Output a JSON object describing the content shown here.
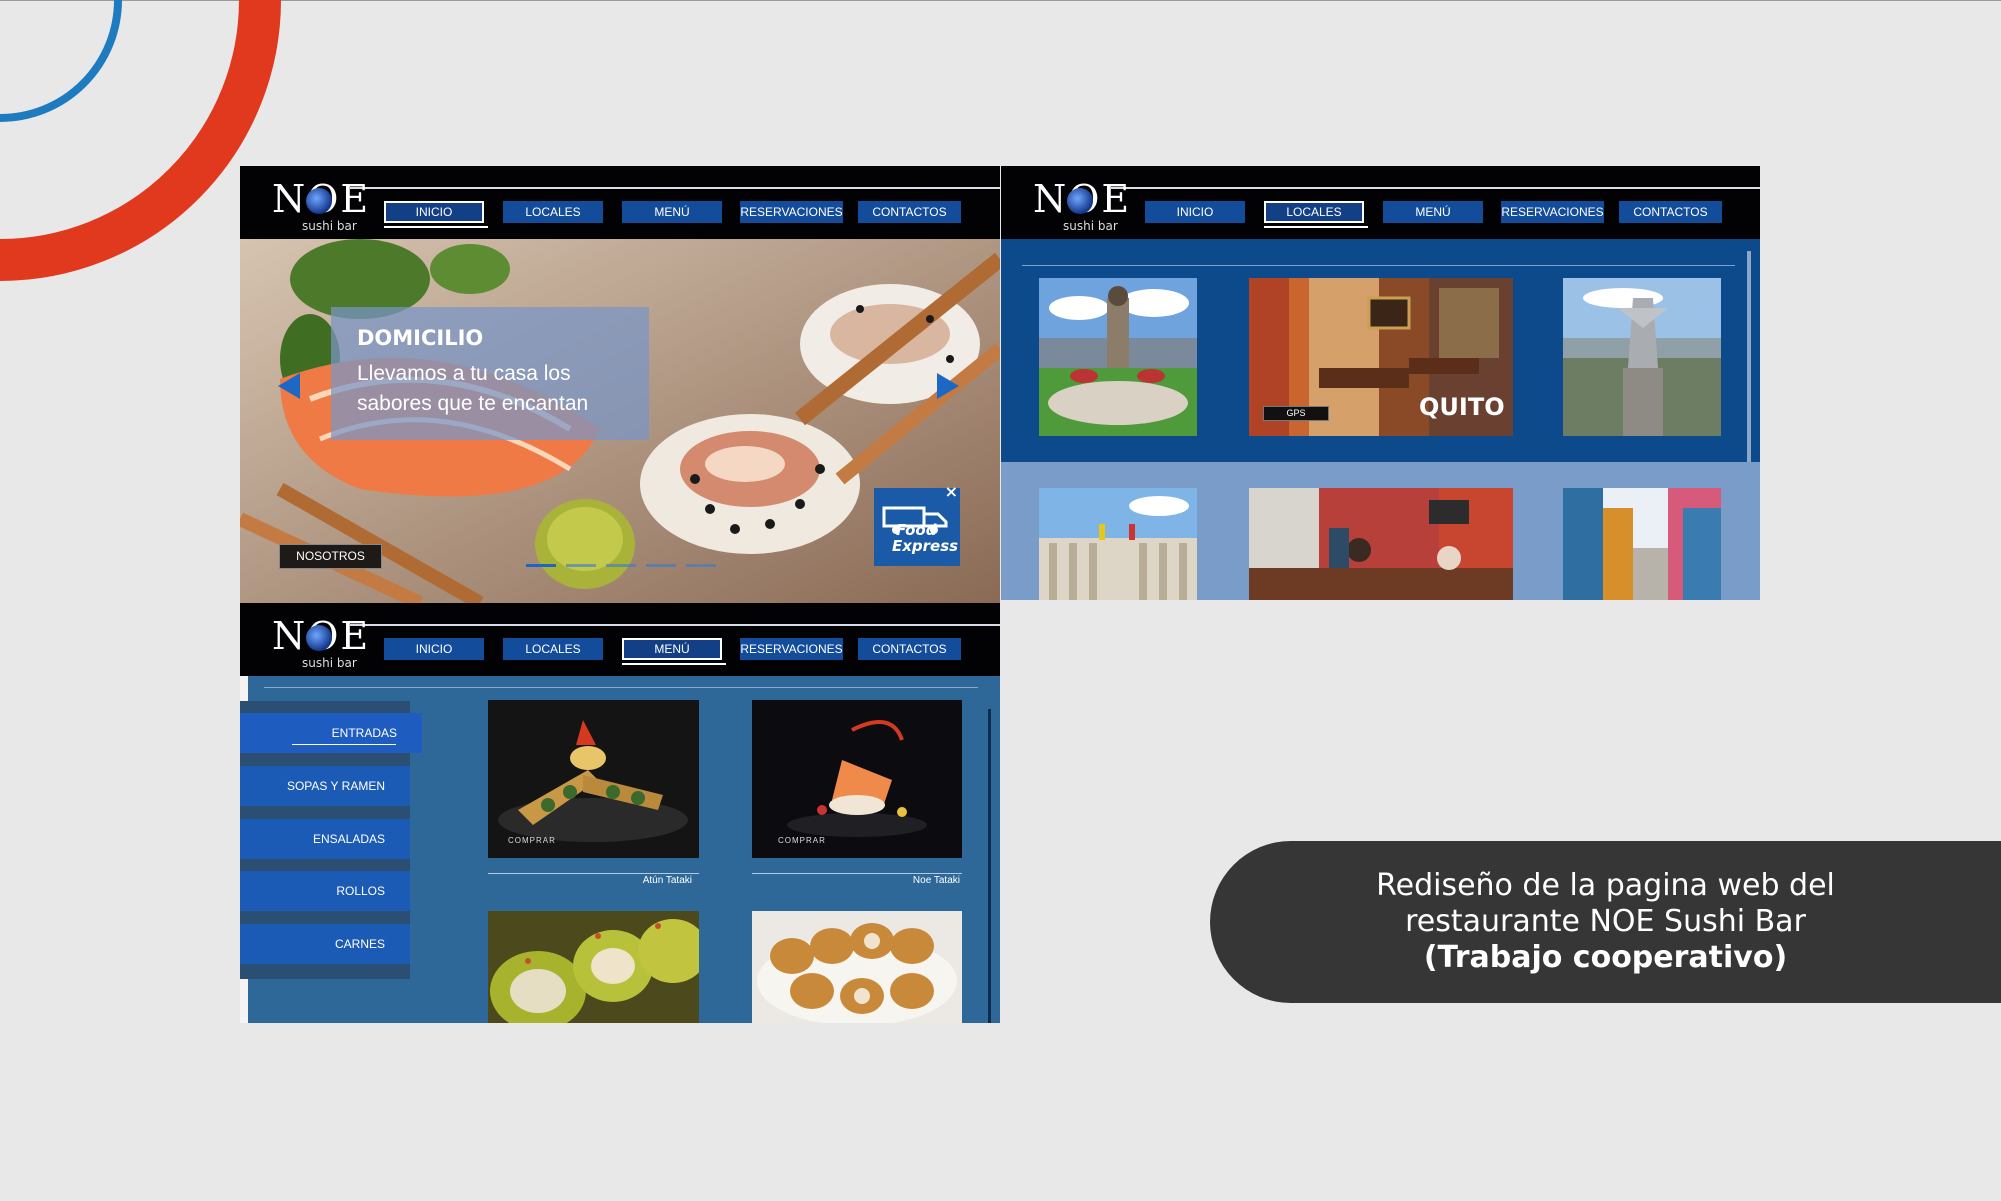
{
  "caption": {
    "line1": "Rediseño de la pagina web del",
    "line2": "restaurante NOE Sushi Bar",
    "line3": "(Trabajo cooperativo)"
  },
  "logo": {
    "brand": "NOE",
    "sub": "sushi bar"
  },
  "nav": [
    "INICIO",
    "LOCALES",
    "MENÚ",
    "RESERVACIONES",
    "CONTACTOS"
  ],
  "home": {
    "active_nav": "INICIO",
    "slide_title": "DOMICILIO",
    "slide_text_1": "Llevamos a tu casa los",
    "slide_text_2": "sabores que te encantan",
    "nosotros_button": "NOSOTROS",
    "promo_title_1": "Food",
    "promo_title_2": "Express",
    "promo_close": "×"
  },
  "locales": {
    "active_nav": "LOCALES",
    "city_label": "QUITO",
    "gps_button": "GPS"
  },
  "menu": {
    "active_nav": "MENÚ",
    "categories": [
      "ENTRADAS",
      "SOPAS Y RAMEN",
      "ENSALADAS",
      "ROLLOS",
      "CARNES"
    ],
    "dishes": [
      {
        "name": "Atún Tataki",
        "buy_label": "COMPRAR"
      },
      {
        "name": "Noe Tataki",
        "buy_label": "COMPRAR"
      }
    ]
  },
  "colors": {
    "accent_blue": "#134c9b",
    "decor_red": "#e0391e",
    "decor_blue": "#1e7bc0",
    "caption_bg": "#363636"
  }
}
